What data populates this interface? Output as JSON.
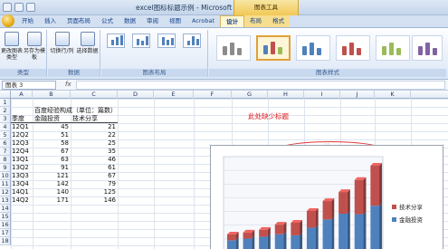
{
  "window": {
    "title": "excel图标标题示例 - Microsoft Excel",
    "context_tools": "图表工具"
  },
  "tabs": [
    {
      "label": "开始"
    },
    {
      "label": "插入"
    },
    {
      "label": "页面布局"
    },
    {
      "label": "公式"
    },
    {
      "label": "数据"
    },
    {
      "label": "审阅"
    },
    {
      "label": "视图"
    },
    {
      "label": "Acrobat"
    },
    {
      "label": "设计"
    },
    {
      "label": "布局"
    },
    {
      "label": "格式"
    }
  ],
  "ribbon": {
    "type_group": {
      "label": "类型",
      "change_type": "更改图表类型",
      "save_template": "另存为模板"
    },
    "data_group": {
      "label": "数据",
      "switch_row_col": "切换行/列",
      "select_data": "选择数据"
    },
    "layout_group": {
      "label": "图表布局"
    },
    "styles_group": {
      "label": "图表样式"
    }
  },
  "formula_bar": {
    "name_box": "图表 3",
    "fx_label": "fx",
    "value": ""
  },
  "columns": [
    "A",
    "B",
    "C",
    "D",
    "E",
    "F",
    "G",
    "H",
    "I",
    "J",
    "K"
  ],
  "rows": [
    "1",
    "2",
    "3",
    "4",
    "5",
    "6",
    "7",
    "8",
    "9",
    "10",
    "11",
    "12",
    "13",
    "14",
    "15",
    "16",
    "17",
    "18"
  ],
  "sheet": {
    "title_cell": "百度经验构成（单位：篇数）",
    "header_b": "金融投资",
    "header_c": "技术分享",
    "header_a": "季度",
    "table": [
      {
        "q": "12Q1",
        "b": "45",
        "c": "21"
      },
      {
        "q": "12Q2",
        "b": "51",
        "c": "22"
      },
      {
        "q": "12Q3",
        "b": "58",
        "c": "25"
      },
      {
        "q": "12Q4",
        "b": "67",
        "c": "35"
      },
      {
        "q": "13Q1",
        "b": "63",
        "c": "46"
      },
      {
        "q": "13Q2",
        "b": "91",
        "c": "61"
      },
      {
        "q": "13Q3",
        "b": "121",
        "c": "67"
      },
      {
        "q": "13Q4",
        "b": "142",
        "c": "79"
      },
      {
        "q": "14Q1",
        "b": "140",
        "c": "125"
      },
      {
        "q": "14Q2",
        "b": "171",
        "c": "146"
      }
    ]
  },
  "annotation": {
    "text": "此处缺少标题",
    "color": "#e0161b"
  },
  "chart_data": {
    "type": "bar",
    "stacked": true,
    "categories": [
      "12Q1",
      "12Q2",
      "12Q3",
      "12Q4",
      "13Q1",
      "13Q2",
      "13Q3",
      "13Q4",
      "14Q1",
      "14Q2"
    ],
    "series": [
      {
        "name": "金融投资",
        "values": [
          45,
          51,
          58,
          67,
          63,
          91,
          121,
          142,
          140,
          171
        ],
        "color": "#4f81bd"
      },
      {
        "name": "技术分享",
        "values": [
          21,
          22,
          25,
          35,
          46,
          61,
          67,
          79,
          125,
          146
        ],
        "color": "#c0504d"
      }
    ],
    "title": "",
    "ylim": [
      0,
      350
    ],
    "legend_position": "right",
    "three_d": true
  },
  "colors": {
    "accent": "#4f81bd",
    "series2": "#c0504d",
    "annotation": "#e23a3a"
  }
}
